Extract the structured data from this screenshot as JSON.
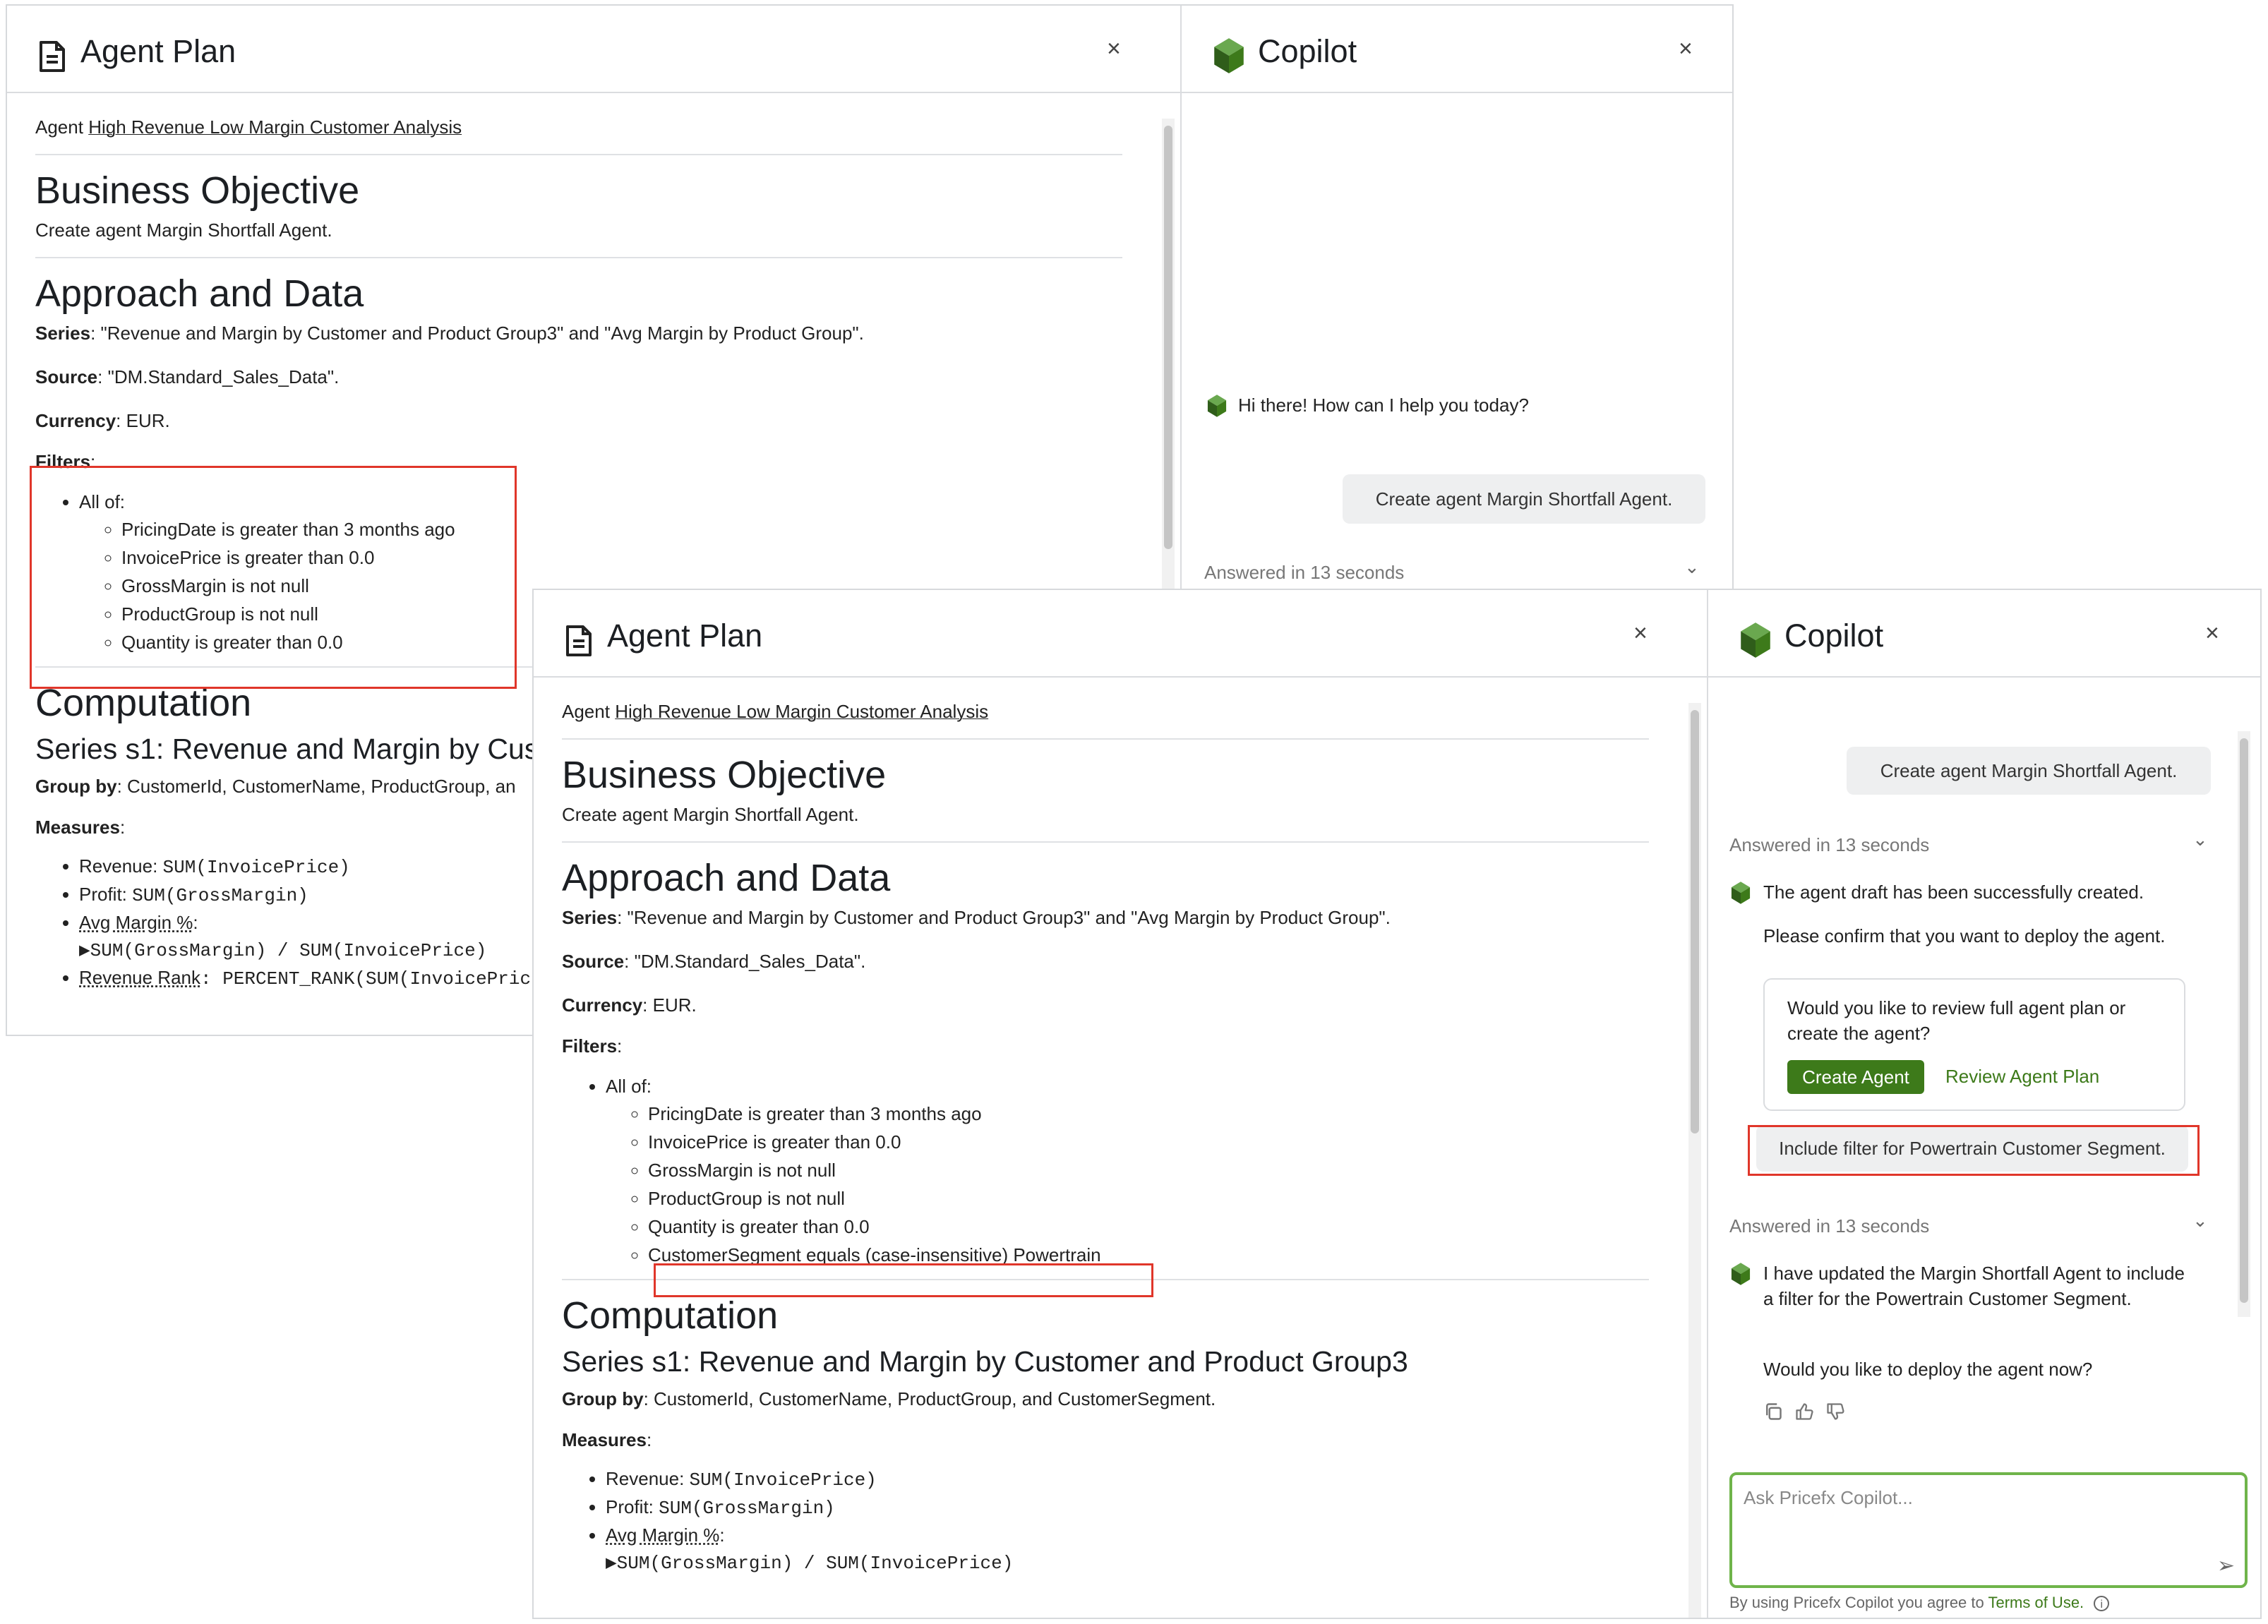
{
  "top_window": {
    "agent_plan": {
      "title": "Agent Plan",
      "close": "×",
      "agent_prefix": "Agent",
      "agent_name": "High Revenue Low Margin Customer Analysis",
      "objective_heading": "Business Objective",
      "objective_text": "Create agent Margin Shortfall Agent.",
      "approach_heading": "Approach and Data",
      "series_label": "Series",
      "series_value": ": \"Revenue and Margin by Customer and Product Group3\" and \"Avg Margin by Product Group\".",
      "source_label": "Source",
      "source_value": ": \"DM.Standard_Sales_Data\".",
      "currency_label": "Currency",
      "currency_value": ": EUR.",
      "filters_label": "Filters",
      "filters_colon": ":",
      "all_of": "All of:",
      "filters": [
        "PricingDate is greater than 3 months ago",
        "InvoicePrice is greater than 0.0",
        "GrossMargin is not null",
        "ProductGroup is not null",
        "Quantity is greater than 0.0"
      ],
      "computation_heading": "Computation",
      "series_s1_heading": "Series s1: Revenue and Margin by Cus",
      "groupby_label": "Group by",
      "groupby_value": ": CustomerId, CustomerName, ProductGroup, an",
      "measures_label": "Measures",
      "measures_colon": ":",
      "measures": {
        "revenue_label": "Revenue: ",
        "revenue_code": "SUM(InvoicePrice)",
        "profit_label": "Profit: ",
        "profit_code": "SUM(GrossMargin)",
        "avg_label": "Avg Margin %",
        "avg_colon": ":",
        "avg_code": "▶SUM(GrossMargin) / SUM(InvoicePrice)",
        "rank_label": "Revenue Rank",
        "rank_code_prefix": ": PERCENT_RANK(SUM(InvoicePric"
      }
    },
    "copilot": {
      "title": "Copilot",
      "close": "×",
      "greeting": "Hi there! How can I help you today?",
      "user_msg": "Create agent Margin Shortfall Agent.",
      "answered": "Answered in 13 seconds",
      "chevron": "⌄"
    }
  },
  "bottom_window": {
    "agent_plan": {
      "title": "Agent Plan",
      "close": "×",
      "agent_prefix": "Agent",
      "agent_name": "High Revenue Low Margin Customer Analysis",
      "objective_heading": "Business Objective",
      "objective_text": "Create agent Margin Shortfall Agent.",
      "approach_heading": "Approach and Data",
      "series_label": "Series",
      "series_value": ": \"Revenue and Margin by Customer and Product Group3\" and \"Avg Margin by Product Group\".",
      "source_label": "Source",
      "source_value": ": \"DM.Standard_Sales_Data\".",
      "currency_label": "Currency",
      "currency_value": ": EUR.",
      "filters_label": "Filters",
      "filters_colon": ":",
      "all_of": "All of:",
      "filters": [
        "PricingDate is greater than 3 months ago",
        "InvoicePrice is greater than 0.0",
        "GrossMargin is not null",
        "ProductGroup is not null",
        "Quantity is greater than 0.0",
        "CustomerSegment equals (case-insensitive) Powertrain"
      ],
      "computation_heading": "Computation",
      "series_s1_heading": "Series s1: Revenue and Margin by Customer and Product Group3",
      "groupby_label": "Group by",
      "groupby_value": ": CustomerId, CustomerName, ProductGroup, and CustomerSegment.",
      "measures_label": "Measures",
      "measures_colon": ":",
      "measures": {
        "revenue_label": "Revenue: ",
        "revenue_code": "SUM(InvoicePrice)",
        "profit_label": "Profit: ",
        "profit_code": "SUM(GrossMargin)",
        "avg_label": "Avg Margin %",
        "avg_colon": ":",
        "avg_code": "▶SUM(GrossMargin) / SUM(InvoicePrice)"
      }
    },
    "copilot": {
      "title": "Copilot",
      "close": "×",
      "user_msg_1": "Create agent Margin Shortfall Agent.",
      "answered_1": "Answered in 13 seconds",
      "bot_msg_1a": "The agent draft has been successfully created.",
      "bot_msg_1b": "Please confirm that you want to deploy the agent.",
      "card_question": "Would you like to review full agent plan or create the agent?",
      "create_agent_btn": "Create Agent",
      "review_plan_link": "Review Agent Plan",
      "user_msg_2": "Include filter for Powertrain Customer Segment.",
      "answered_2": "Answered in 13 seconds",
      "bot_msg_2a": "I have updated the Margin Shortfall Agent to include a filter for the Powertrain Customer Segment.",
      "bot_msg_2b": "Would you like to deploy the agent now?",
      "chevron": "⌄",
      "input_placeholder": "Ask Pricefx Copilot...",
      "terms_prefix": "By using Pricefx Copilot you agree to ",
      "terms_link": "Terms of Use.",
      "info": "i",
      "send": "➢"
    }
  },
  "colors": {
    "accent_green": "#3d7a1a",
    "highlight_red": "#e0362a",
    "input_border_green": "#6fb44a"
  }
}
